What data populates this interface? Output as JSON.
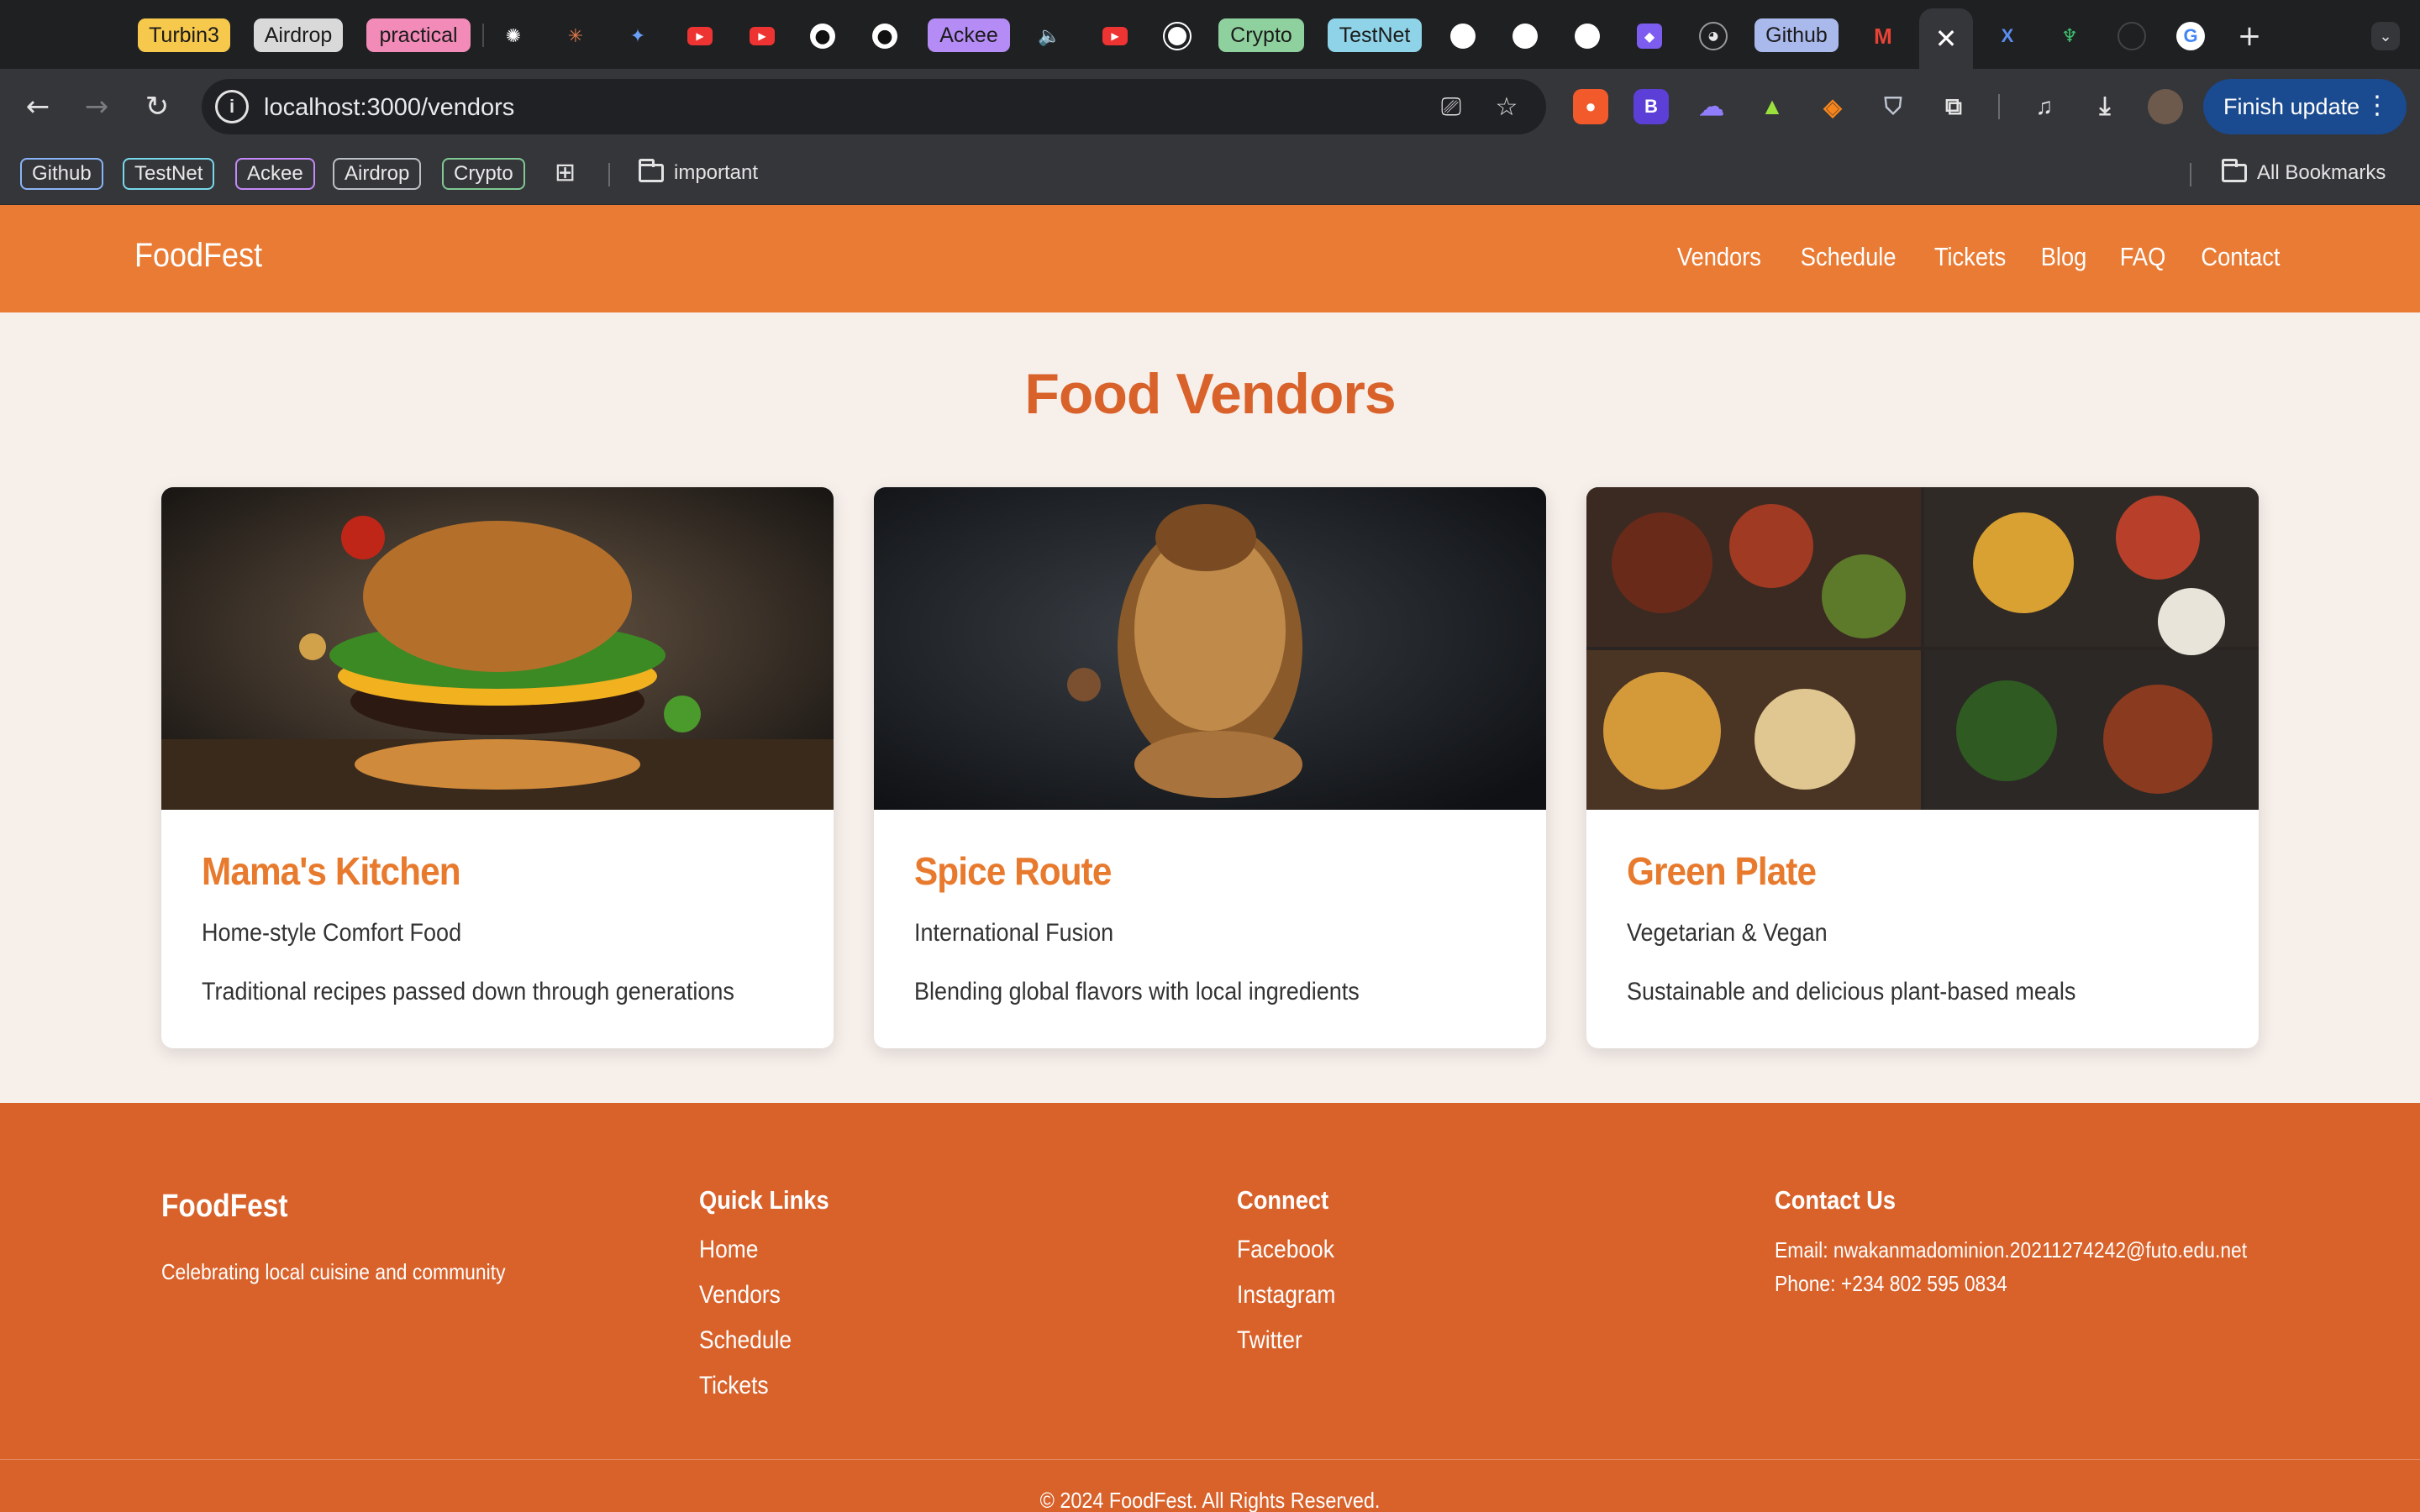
{
  "browser": {
    "tabs": [
      {
        "label": "Turbin3",
        "bg": "#f6c84c"
      },
      {
        "label": "Airdrop",
        "bg": "#d9d9d9"
      },
      {
        "label": "practical",
        "bg": "#f28bb8"
      },
      {
        "label": "Ackee",
        "bg": "#b58cf5"
      },
      {
        "label": "Crypto",
        "bg": "#8fd19e"
      },
      {
        "label": "TestNet",
        "bg": "#8fd3e8"
      },
      {
        "label": "Github",
        "bg": "#aab9ec"
      }
    ],
    "address": "localhost:3000/vendors",
    "update_button": "Finish update",
    "bookmarks": [
      {
        "label": "Github",
        "border": "#8ab4f8"
      },
      {
        "label": "TestNet",
        "border": "#78d9ec"
      },
      {
        "label": "Ackee",
        "border": "#c58af9"
      },
      {
        "label": "Airdrop",
        "border": "#bdc1c6"
      },
      {
        "label": "Crypto",
        "border": "#81c995"
      }
    ],
    "bookmark_folder": "important",
    "all_bookmarks": "All Bookmarks"
  },
  "site": {
    "logo": "FoodFest",
    "nav": [
      "Vendors",
      "Schedule",
      "Tickets",
      "Blog",
      "FAQ",
      "Contact"
    ],
    "title": "Food Vendors",
    "vendors": [
      {
        "name": "Mama's Kitchen",
        "cuisine": "Home-style Comfort Food",
        "description": "Traditional recipes passed down through generations",
        "image": "burger-photo"
      },
      {
        "name": "Spice Route",
        "cuisine": "International Fusion",
        "description": "Blending global flavors with local ingredients",
        "image": "pasta-photo"
      },
      {
        "name": "Green Plate",
        "cuisine": "Vegetarian & Vegan",
        "description": "Sustainable and delicious plant-based meals",
        "image": "dishes-collage-photo"
      }
    ],
    "footer": {
      "brand": "FoodFest",
      "tagline": "Celebrating local cuisine and community",
      "quick_links_title": "Quick Links",
      "quick_links": [
        "Home",
        "Vendors",
        "Schedule",
        "Tickets"
      ],
      "connect_title": "Connect",
      "connect": [
        "Facebook",
        "Instagram",
        "Twitter"
      ],
      "contact_title": "Contact Us",
      "email": "Email: nwakanmadominion.20211274242@futo.edu.net",
      "phone": "Phone: +234 802 595 0834",
      "copyright": "© 2024 FoodFest. All Rights Reserved."
    },
    "colors": {
      "header": "#ea7b34",
      "footer": "#d9612a",
      "accent": "#e87a2e",
      "background": "#f7efea"
    }
  }
}
